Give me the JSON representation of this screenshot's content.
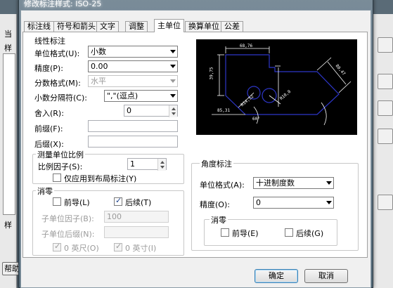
{
  "background": {
    "left_text_1": "当",
    "left_text_2": "样",
    "left_text_3": "样",
    "help_button": "帮助"
  },
  "dialog": {
    "title": "修改标注样式: ISO-25"
  },
  "tabs": [
    {
      "label": "标注线"
    },
    {
      "label": "符号和箭头"
    },
    {
      "label": "文字"
    },
    {
      "label": "调整"
    },
    {
      "label": "主单位"
    },
    {
      "label": "换算单位"
    },
    {
      "label": "公差"
    }
  ],
  "linear": {
    "group_title": "线性标注",
    "unit_format_label": "单位格式(U):",
    "unit_format_value": "小数",
    "precision_label": "精度(P):",
    "precision_value": "0.00",
    "fraction_label": "分数格式(M):",
    "fraction_value": "水平",
    "decimal_sep_label": "小数分隔符(C):",
    "decimal_sep_value": "\",\"(逗点)",
    "round_label": "舍入(R):",
    "round_value": "0",
    "prefix_label": "前缀(F):",
    "prefix_value": "",
    "suffix_label": "后缀(X):",
    "suffix_value": ""
  },
  "scale": {
    "group_title": "测量单位比例",
    "factor_label": "比例因子(S):",
    "factor_value": "1",
    "layout_only_label": "仅应用到布局标注(Y)"
  },
  "zero_linear": {
    "group_title": "消零",
    "leading_label": "前导(L)",
    "trailing_label": "后续(T)",
    "sub_factor_label": "子单位因子(B):",
    "sub_factor_value": "100",
    "sub_suffix_label": "子单位后缀(N):",
    "sub_suffix_value": "",
    "feet_label": "0 英尺(O)",
    "inch_label": "0 英寸(I)"
  },
  "angular": {
    "group_title": "角度标注",
    "unit_format_label": "单位格式(A):",
    "unit_format_value": "十进制度数",
    "precision_label": "精度(O):",
    "precision_value": "0",
    "zero_group_title": "消零",
    "leading_label": "前导(E)",
    "trailing_label": "后续(G)"
  },
  "preview": {
    "dim_top": "68,76",
    "dim_left": "39,75",
    "dim_right": "80,47",
    "dim_bottom": "85,31",
    "dim_radius": "R14,52",
    "dim_angle": "60°",
    "dim_diag": "R10,0"
  },
  "footer": {
    "ok_label": "确定",
    "cancel_label": "取消"
  },
  "colors": {
    "preview_bg": "#000000",
    "shape_stroke": "#2d36c8",
    "dim_stroke": "#ffffff"
  }
}
